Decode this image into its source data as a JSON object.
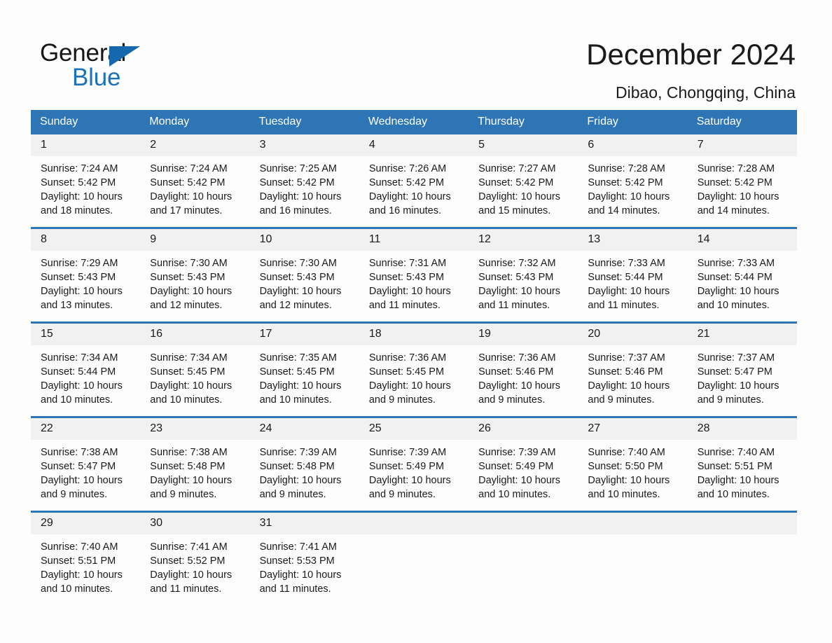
{
  "brand": {
    "name_part1": "General",
    "name_part2": "Blue",
    "triangle_color": "#1567ae",
    "blue": "#1b72bb"
  },
  "header": {
    "title": "December 2024",
    "location": "Dibao, Chongqing, China",
    "accent_color": "#2e75b6",
    "daynum_band_color": "#f1f1f1"
  },
  "weekdays": [
    "Sunday",
    "Monday",
    "Tuesday",
    "Wednesday",
    "Thursday",
    "Friday",
    "Saturday"
  ],
  "weeks": [
    [
      {
        "day": "1",
        "sunrise": "Sunrise: 7:24 AM",
        "sunset": "Sunset: 5:42 PM",
        "daylight1": "Daylight: 10 hours",
        "daylight2": "and 18 minutes."
      },
      {
        "day": "2",
        "sunrise": "Sunrise: 7:24 AM",
        "sunset": "Sunset: 5:42 PM",
        "daylight1": "Daylight: 10 hours",
        "daylight2": "and 17 minutes."
      },
      {
        "day": "3",
        "sunrise": "Sunrise: 7:25 AM",
        "sunset": "Sunset: 5:42 PM",
        "daylight1": "Daylight: 10 hours",
        "daylight2": "and 16 minutes."
      },
      {
        "day": "4",
        "sunrise": "Sunrise: 7:26 AM",
        "sunset": "Sunset: 5:42 PM",
        "daylight1": "Daylight: 10 hours",
        "daylight2": "and 16 minutes."
      },
      {
        "day": "5",
        "sunrise": "Sunrise: 7:27 AM",
        "sunset": "Sunset: 5:42 PM",
        "daylight1": "Daylight: 10 hours",
        "daylight2": "and 15 minutes."
      },
      {
        "day": "6",
        "sunrise": "Sunrise: 7:28 AM",
        "sunset": "Sunset: 5:42 PM",
        "daylight1": "Daylight: 10 hours",
        "daylight2": "and 14 minutes."
      },
      {
        "day": "7",
        "sunrise": "Sunrise: 7:28 AM",
        "sunset": "Sunset: 5:42 PM",
        "daylight1": "Daylight: 10 hours",
        "daylight2": "and 14 minutes."
      }
    ],
    [
      {
        "day": "8",
        "sunrise": "Sunrise: 7:29 AM",
        "sunset": "Sunset: 5:43 PM",
        "daylight1": "Daylight: 10 hours",
        "daylight2": "and 13 minutes."
      },
      {
        "day": "9",
        "sunrise": "Sunrise: 7:30 AM",
        "sunset": "Sunset: 5:43 PM",
        "daylight1": "Daylight: 10 hours",
        "daylight2": "and 12 minutes."
      },
      {
        "day": "10",
        "sunrise": "Sunrise: 7:30 AM",
        "sunset": "Sunset: 5:43 PM",
        "daylight1": "Daylight: 10 hours",
        "daylight2": "and 12 minutes."
      },
      {
        "day": "11",
        "sunrise": "Sunrise: 7:31 AM",
        "sunset": "Sunset: 5:43 PM",
        "daylight1": "Daylight: 10 hours",
        "daylight2": "and 11 minutes."
      },
      {
        "day": "12",
        "sunrise": "Sunrise: 7:32 AM",
        "sunset": "Sunset: 5:43 PM",
        "daylight1": "Daylight: 10 hours",
        "daylight2": "and 11 minutes."
      },
      {
        "day": "13",
        "sunrise": "Sunrise: 7:33 AM",
        "sunset": "Sunset: 5:44 PM",
        "daylight1": "Daylight: 10 hours",
        "daylight2": "and 11 minutes."
      },
      {
        "day": "14",
        "sunrise": "Sunrise: 7:33 AM",
        "sunset": "Sunset: 5:44 PM",
        "daylight1": "Daylight: 10 hours",
        "daylight2": "and 10 minutes."
      }
    ],
    [
      {
        "day": "15",
        "sunrise": "Sunrise: 7:34 AM",
        "sunset": "Sunset: 5:44 PM",
        "daylight1": "Daylight: 10 hours",
        "daylight2": "and 10 minutes."
      },
      {
        "day": "16",
        "sunrise": "Sunrise: 7:34 AM",
        "sunset": "Sunset: 5:45 PM",
        "daylight1": "Daylight: 10 hours",
        "daylight2": "and 10 minutes."
      },
      {
        "day": "17",
        "sunrise": "Sunrise: 7:35 AM",
        "sunset": "Sunset: 5:45 PM",
        "daylight1": "Daylight: 10 hours",
        "daylight2": "and 10 minutes."
      },
      {
        "day": "18",
        "sunrise": "Sunrise: 7:36 AM",
        "sunset": "Sunset: 5:45 PM",
        "daylight1": "Daylight: 10 hours",
        "daylight2": "and 9 minutes."
      },
      {
        "day": "19",
        "sunrise": "Sunrise: 7:36 AM",
        "sunset": "Sunset: 5:46 PM",
        "daylight1": "Daylight: 10 hours",
        "daylight2": "and 9 minutes."
      },
      {
        "day": "20",
        "sunrise": "Sunrise: 7:37 AM",
        "sunset": "Sunset: 5:46 PM",
        "daylight1": "Daylight: 10 hours",
        "daylight2": "and 9 minutes."
      },
      {
        "day": "21",
        "sunrise": "Sunrise: 7:37 AM",
        "sunset": "Sunset: 5:47 PM",
        "daylight1": "Daylight: 10 hours",
        "daylight2": "and 9 minutes."
      }
    ],
    [
      {
        "day": "22",
        "sunrise": "Sunrise: 7:38 AM",
        "sunset": "Sunset: 5:47 PM",
        "daylight1": "Daylight: 10 hours",
        "daylight2": "and 9 minutes."
      },
      {
        "day": "23",
        "sunrise": "Sunrise: 7:38 AM",
        "sunset": "Sunset: 5:48 PM",
        "daylight1": "Daylight: 10 hours",
        "daylight2": "and 9 minutes."
      },
      {
        "day": "24",
        "sunrise": "Sunrise: 7:39 AM",
        "sunset": "Sunset: 5:48 PM",
        "daylight1": "Daylight: 10 hours",
        "daylight2": "and 9 minutes."
      },
      {
        "day": "25",
        "sunrise": "Sunrise: 7:39 AM",
        "sunset": "Sunset: 5:49 PM",
        "daylight1": "Daylight: 10 hours",
        "daylight2": "and 9 minutes."
      },
      {
        "day": "26",
        "sunrise": "Sunrise: 7:39 AM",
        "sunset": "Sunset: 5:49 PM",
        "daylight1": "Daylight: 10 hours",
        "daylight2": "and 10 minutes."
      },
      {
        "day": "27",
        "sunrise": "Sunrise: 7:40 AM",
        "sunset": "Sunset: 5:50 PM",
        "daylight1": "Daylight: 10 hours",
        "daylight2": "and 10 minutes."
      },
      {
        "day": "28",
        "sunrise": "Sunrise: 7:40 AM",
        "sunset": "Sunset: 5:51 PM",
        "daylight1": "Daylight: 10 hours",
        "daylight2": "and 10 minutes."
      }
    ],
    [
      {
        "day": "29",
        "sunrise": "Sunrise: 7:40 AM",
        "sunset": "Sunset: 5:51 PM",
        "daylight1": "Daylight: 10 hours",
        "daylight2": "and 10 minutes."
      },
      {
        "day": "30",
        "sunrise": "Sunrise: 7:41 AM",
        "sunset": "Sunset: 5:52 PM",
        "daylight1": "Daylight: 10 hours",
        "daylight2": "and 11 minutes."
      },
      {
        "day": "31",
        "sunrise": "Sunrise: 7:41 AM",
        "sunset": "Sunset: 5:53 PM",
        "daylight1": "Daylight: 10 hours",
        "daylight2": "and 11 minutes."
      },
      {
        "day": "",
        "sunrise": "",
        "sunset": "",
        "daylight1": "",
        "daylight2": ""
      },
      {
        "day": "",
        "sunrise": "",
        "sunset": "",
        "daylight1": "",
        "daylight2": ""
      },
      {
        "day": "",
        "sunrise": "",
        "sunset": "",
        "daylight1": "",
        "daylight2": ""
      },
      {
        "day": "",
        "sunrise": "",
        "sunset": "",
        "daylight1": "",
        "daylight2": ""
      }
    ]
  ]
}
